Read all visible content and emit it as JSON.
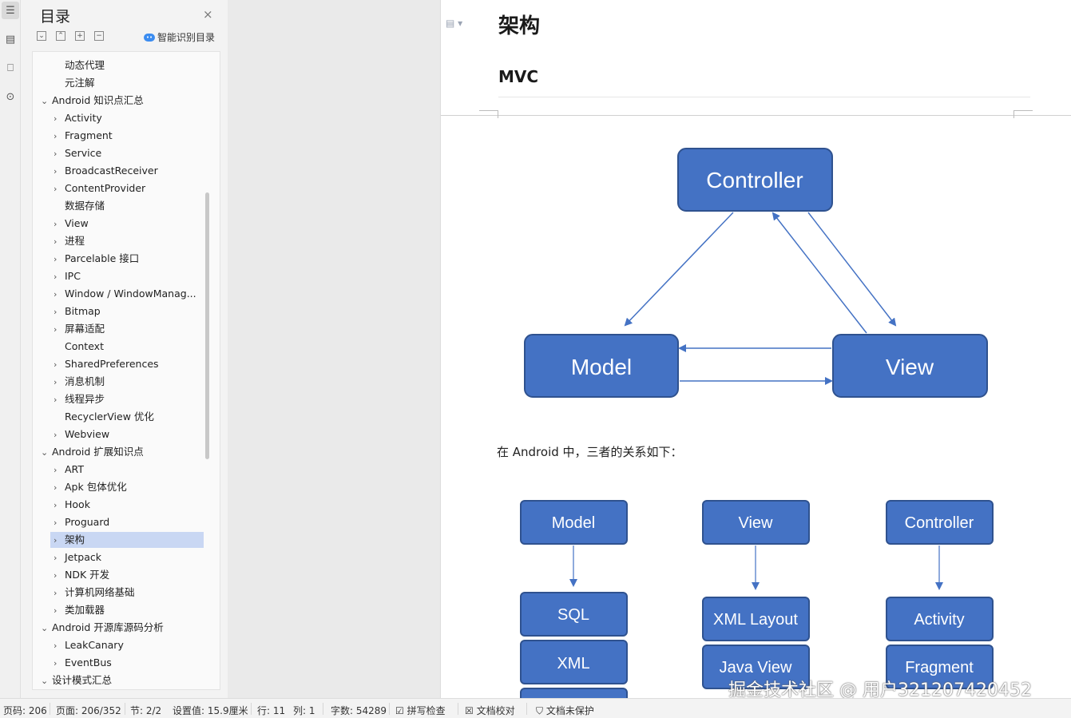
{
  "panel": {
    "title": "目录",
    "close_icon": "×",
    "smart_label": "智能识别目录",
    "tools": [
      "expand-all-icon",
      "collapse-all-icon",
      "add-heading-icon",
      "remove-heading-icon"
    ]
  },
  "outline": [
    {
      "label": "动态代理",
      "level": 2,
      "chevron": ""
    },
    {
      "label": "元注解",
      "level": 2,
      "chevron": ""
    },
    {
      "label": "Android 知识点汇总",
      "level": 1,
      "chevron": "v"
    },
    {
      "label": "Activity",
      "level": 2,
      "chevron": ">"
    },
    {
      "label": "Fragment",
      "level": 2,
      "chevron": ">"
    },
    {
      "label": "Service",
      "level": 2,
      "chevron": ">"
    },
    {
      "label": "BroadcastReceiver",
      "level": 2,
      "chevron": ">"
    },
    {
      "label": "ContentProvider",
      "level": 2,
      "chevron": ">"
    },
    {
      "label": "数据存储",
      "level": 2,
      "chevron": ""
    },
    {
      "label": "View",
      "level": 2,
      "chevron": ">"
    },
    {
      "label": "进程",
      "level": 2,
      "chevron": ">"
    },
    {
      "label": "Parcelable 接口",
      "level": 2,
      "chevron": ">"
    },
    {
      "label": "IPC",
      "level": 2,
      "chevron": ">"
    },
    {
      "label": "Window / WindowManag...",
      "level": 2,
      "chevron": ">"
    },
    {
      "label": "Bitmap",
      "level": 2,
      "chevron": ">"
    },
    {
      "label": "屏幕适配",
      "level": 2,
      "chevron": ">"
    },
    {
      "label": "Context",
      "level": 2,
      "chevron": ""
    },
    {
      "label": "SharedPreferences",
      "level": 2,
      "chevron": ">"
    },
    {
      "label": "消息机制",
      "level": 2,
      "chevron": ">"
    },
    {
      "label": "线程异步",
      "level": 2,
      "chevron": ">"
    },
    {
      "label": "RecyclerView 优化",
      "level": 2,
      "chevron": ""
    },
    {
      "label": "Webview",
      "level": 2,
      "chevron": ">"
    },
    {
      "label": "Android 扩展知识点",
      "level": 1,
      "chevron": "v"
    },
    {
      "label": "ART",
      "level": 2,
      "chevron": ">"
    },
    {
      "label": "Apk 包体优化",
      "level": 2,
      "chevron": ">"
    },
    {
      "label": "Hook",
      "level": 2,
      "chevron": ">"
    },
    {
      "label": "Proguard",
      "level": 2,
      "chevron": ">"
    },
    {
      "label": "架构",
      "level": 2,
      "chevron": ">",
      "selected": true
    },
    {
      "label": "Jetpack",
      "level": 2,
      "chevron": ">"
    },
    {
      "label": "NDK 开发",
      "level": 2,
      "chevron": ">"
    },
    {
      "label": "计算机网络基础",
      "level": 2,
      "chevron": ">"
    },
    {
      "label": "类加载器",
      "level": 2,
      "chevron": ">"
    },
    {
      "label": "Android 开源库源码分析",
      "level": 1,
      "chevron": "v"
    },
    {
      "label": "LeakCanary",
      "level": 2,
      "chevron": ">"
    },
    {
      "label": "EventBus",
      "level": 2,
      "chevron": ">"
    },
    {
      "label": "设计模式汇总",
      "level": 1,
      "chevron": "v"
    }
  ],
  "document": {
    "title": "架构",
    "subtitle": "MVC",
    "paragraph": "在  Android  中，三者的关系如下：",
    "diagram1": {
      "controller": "Controller",
      "model": "Model",
      "view": "View"
    },
    "diagram2": {
      "col1": [
        "Model",
        "SQL",
        "XML"
      ],
      "col2": [
        "View",
        "XML Layout",
        "Java View"
      ],
      "col3": [
        "Controller",
        "Activity",
        "Fragment"
      ]
    },
    "colors": {
      "box_fill": "#4472c4",
      "box_stroke": "#2f528f",
      "arrow": "#4472c4"
    }
  },
  "watermark": "掘金技术社区 @ 用户321207420452",
  "status": {
    "page_code": "页码: 206",
    "page": "页面: 206/352",
    "section": "节: 2/2",
    "setting": "设置值: 15.9厘米",
    "row": "行: 11",
    "col": "列: 1",
    "words": "字数: 54289",
    "spell": "拼写检查",
    "proof": "文档校对",
    "protect": "文档未保护"
  }
}
